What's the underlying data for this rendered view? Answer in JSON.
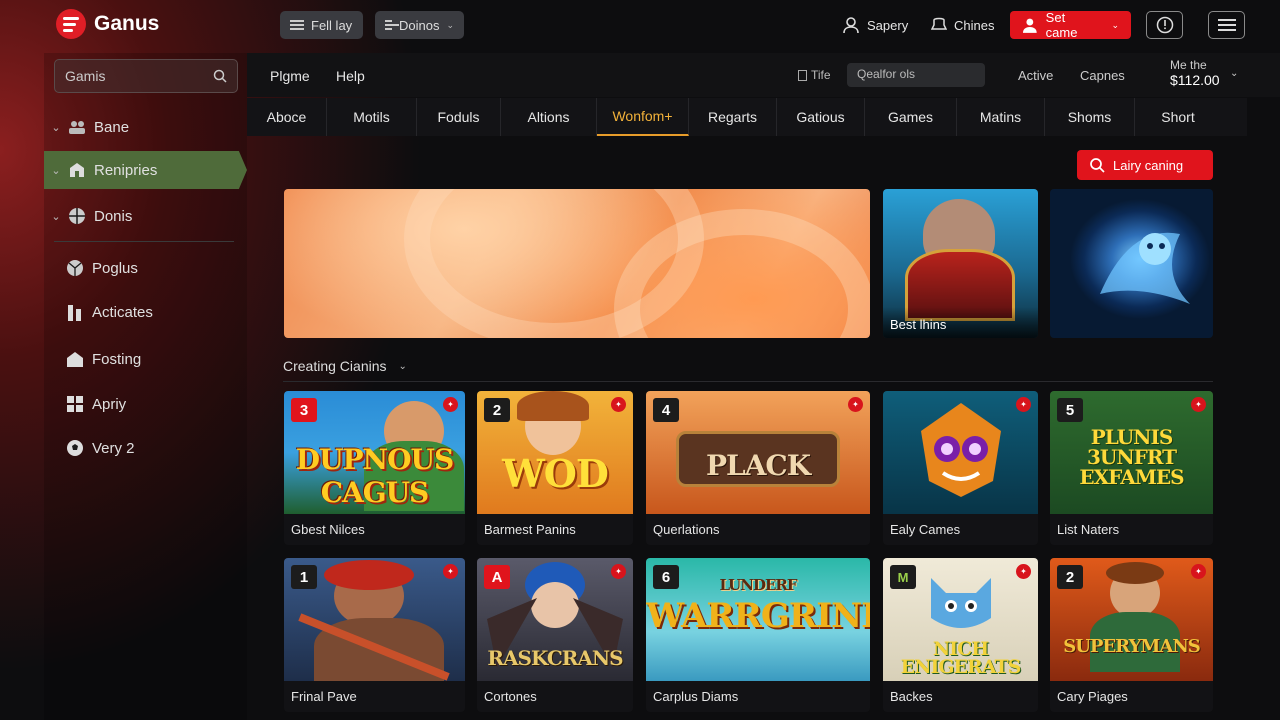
{
  "app": {
    "name": "Ganus"
  },
  "topbar": {
    "pill_left": "Fell lay",
    "pill_right": "Doinos",
    "user_link": "Sapery",
    "chines_link": "Chines",
    "cta": "Set came"
  },
  "sidebar": {
    "search_placeholder": "Gamis",
    "items": [
      {
        "label": "Bane",
        "icon": "users-icon"
      },
      {
        "label": "Renipries",
        "icon": "building-icon",
        "active": true
      },
      {
        "label": "Donis",
        "icon": "globe-icon"
      },
      {
        "label": "Poglus",
        "icon": "ball-icon"
      },
      {
        "label": "Acticates",
        "icon": "bars-icon"
      },
      {
        "label": "Fosting",
        "icon": "home-icon"
      },
      {
        "label": "Apriy",
        "icon": "grid-icon"
      },
      {
        "label": "Very 2",
        "icon": "soccer-icon"
      }
    ]
  },
  "subbar": {
    "links": [
      "Plgme",
      "Help"
    ],
    "title_label": "Tife",
    "filter_placeholder": "Qealfor ols",
    "status_active": "Active",
    "status_capnes": "Capnes",
    "balance_label": "Me the",
    "balance_value": "$112.00"
  },
  "tabs": [
    "Aboce",
    "Motils",
    "Foduls",
    "Altions",
    "Wonfom+",
    "Regarts",
    "Gatious",
    "Games",
    "Matins",
    "Shoms",
    "Short"
  ],
  "active_tab": "Wonfom+",
  "search_button": "Lairy caning",
  "featured": {
    "thumb_caption": "Best lhins"
  },
  "section": {
    "title": "Creating Cianins"
  },
  "cards_row1": [
    {
      "num": "3",
      "num_red": true,
      "art": "DUPNOUS CAGUS",
      "caption": "Gbest Nilces"
    },
    {
      "num": "2",
      "num_red": false,
      "art": "WOD",
      "caption": "Barmest Panins"
    },
    {
      "num": "4",
      "num_red": false,
      "art": "PLACK",
      "caption": "Querlations"
    },
    {
      "num": "",
      "num_red": false,
      "art": "",
      "caption": "Ealy Cames"
    },
    {
      "num": "5",
      "num_red": false,
      "art": "PLUNIS 3UNFRT EXFAMES",
      "caption": "List Naters"
    }
  ],
  "cards_row2": [
    {
      "num": "1",
      "num_red": false,
      "art": "",
      "caption": "Frinal Pave"
    },
    {
      "num": "A",
      "num_red": true,
      "art": "RASKCRANS",
      "caption": "Cortones"
    },
    {
      "num": "6",
      "num_red": false,
      "art": "LUNDERF WARRGRINES",
      "caption": "Carplus Diams"
    },
    {
      "num": "M",
      "num_red": false,
      "art": "NICH ENIGERATS",
      "caption": "Backes"
    },
    {
      "num": "2",
      "num_red": false,
      "art": "SUPERYMANS",
      "caption": "Cary Piages"
    }
  ],
  "colors": {
    "brand": "#e0141c",
    "accent_tab": "#f3b23a",
    "sidebar_active": "#4f6b3a"
  }
}
